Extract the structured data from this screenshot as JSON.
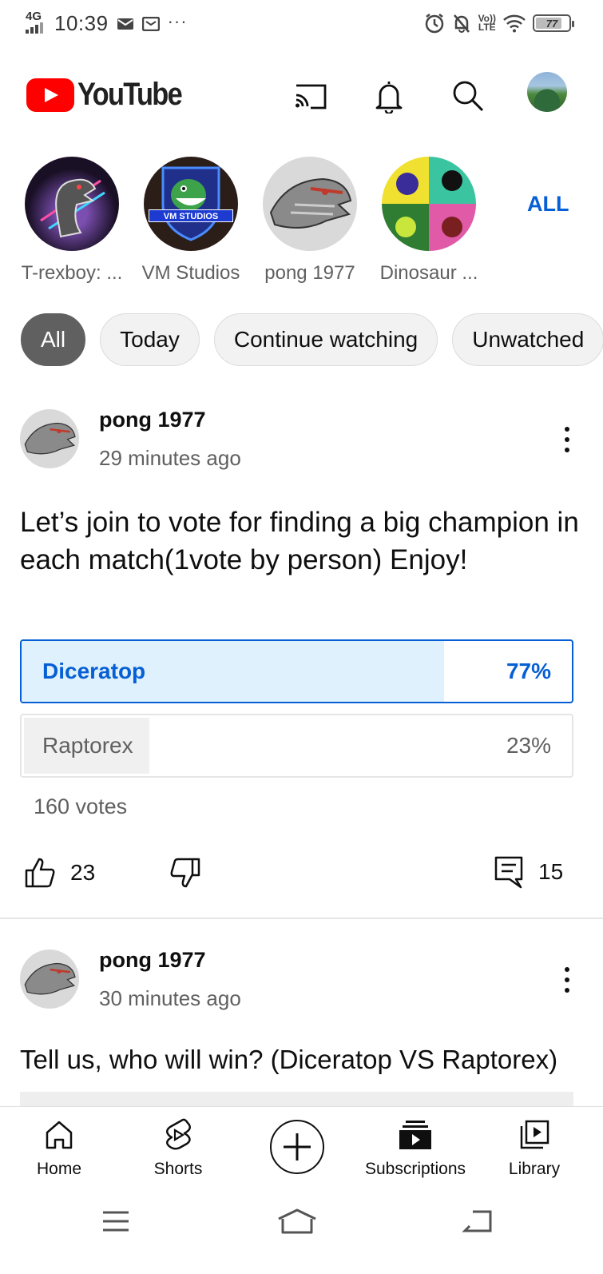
{
  "status_bar": {
    "network": "4G",
    "time": "10:39",
    "more": "···",
    "volte": "Vo))",
    "lte": "LTE",
    "battery": "77"
  },
  "app": {
    "name": "YouTube",
    "brand_color": "#ff0000",
    "accent_color": "#065fd4"
  },
  "channels": {
    "items": [
      {
        "name": "T-rexboy: ..."
      },
      {
        "name": "VM Studios",
        "badge": "VM STUDIOS"
      },
      {
        "name": "pong 1977"
      },
      {
        "name": "Dinosaur ..."
      }
    ],
    "all_label": "ALL"
  },
  "chips": [
    "All",
    "Today",
    "Continue watching",
    "Unwatched"
  ],
  "posts": [
    {
      "author": "pong 1977",
      "time": "29 minutes ago",
      "text": "Let’s join to vote for finding a big champion in each match(1vote by person) Enjoy!",
      "poll": {
        "options": [
          {
            "label": "Diceratop",
            "percent": "77%",
            "selected": true
          },
          {
            "label": "Raptorex",
            "percent": "23%",
            "selected": false
          }
        ],
        "votes": "160 votes"
      },
      "likes": "23",
      "comments": "15"
    },
    {
      "author": "pong 1977",
      "time": "30 minutes ago",
      "text": "Tell us, who will win? (Diceratop  VS Raptorex)"
    }
  ],
  "bottom_nav": {
    "home": "Home",
    "shorts": "Shorts",
    "subscriptions": "Subscriptions",
    "library": "Library"
  }
}
